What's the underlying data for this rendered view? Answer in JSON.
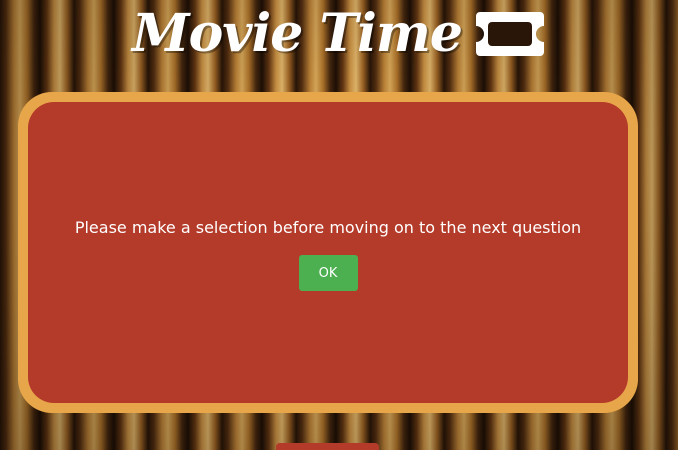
{
  "header": {
    "title": "Movie Time",
    "icon": "ticket-icon"
  },
  "dialog": {
    "message": "Please make a selection before moving on to the next question",
    "ok_label": "OK"
  },
  "colors": {
    "dialog_background": "#b43a29",
    "dialog_border": "#e8a64a",
    "ok_button": "#4caf50",
    "text": "#ffffff"
  }
}
